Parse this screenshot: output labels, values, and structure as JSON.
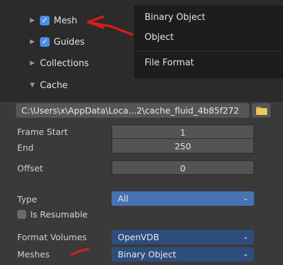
{
  "tree": {
    "mesh": "Mesh",
    "guides": "Guides",
    "collections": "Collections",
    "cache": "Cache"
  },
  "menu": {
    "items": [
      "Binary Object",
      "Object",
      "File Format"
    ]
  },
  "cache": {
    "path": "C:\\Users\\x\\AppData\\Loca...2\\cache_fluid_4b85f272",
    "frame_start_label": "Frame Start",
    "frame_start": "1",
    "end_label": "End",
    "end": "250",
    "offset_label": "Offset",
    "offset": "0",
    "type_label": "Type",
    "type_value": "All",
    "resumable_label": "Is Resumable",
    "format_volumes_label": "Format Volumes",
    "format_volumes_value": "OpenVDB",
    "meshes_label": "Meshes",
    "meshes_value": "Binary Object"
  },
  "colors": {
    "annotation_red": "#e11b1b",
    "accent_blue": "#4772b3"
  }
}
